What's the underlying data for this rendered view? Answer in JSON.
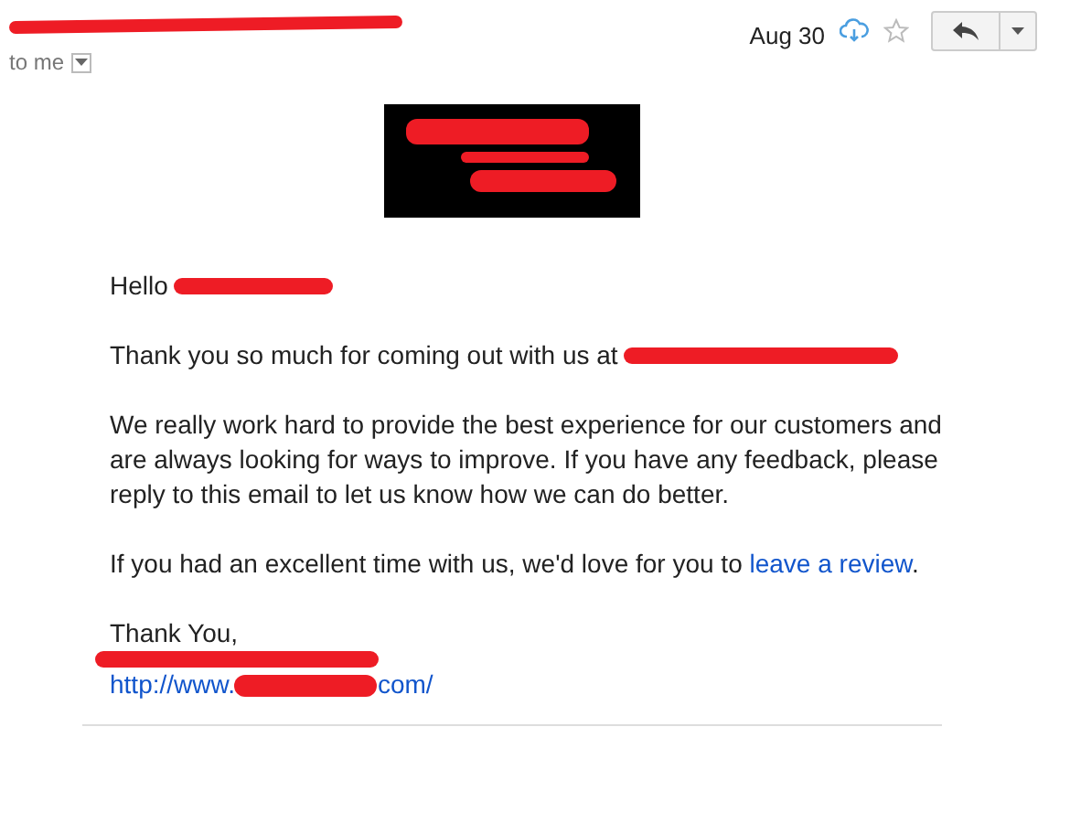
{
  "header": {
    "recipient": "to me",
    "date": "Aug 30",
    "starred": false
  },
  "body": [
    {
      "kind": "greeting",
      "text": "Hello"
    },
    {
      "kind": "redacted-end",
      "text": "Thank you so much for coming out with us at"
    },
    {
      "kind": "paragraph",
      "text": "We really work hard to provide the best experience for our customers and are always looking for ways to improve. If you have any feedback, please reply to this email to let us know how we can do better."
    },
    {
      "kind": "link-end",
      "text": "If you had an excellent time with us, we'd love for you to",
      "link": "leave a review",
      "after": "."
    }
  ],
  "signature": {
    "closing": "Thank You,",
    "url_start": "http://www.",
    "url_end": "com/"
  }
}
